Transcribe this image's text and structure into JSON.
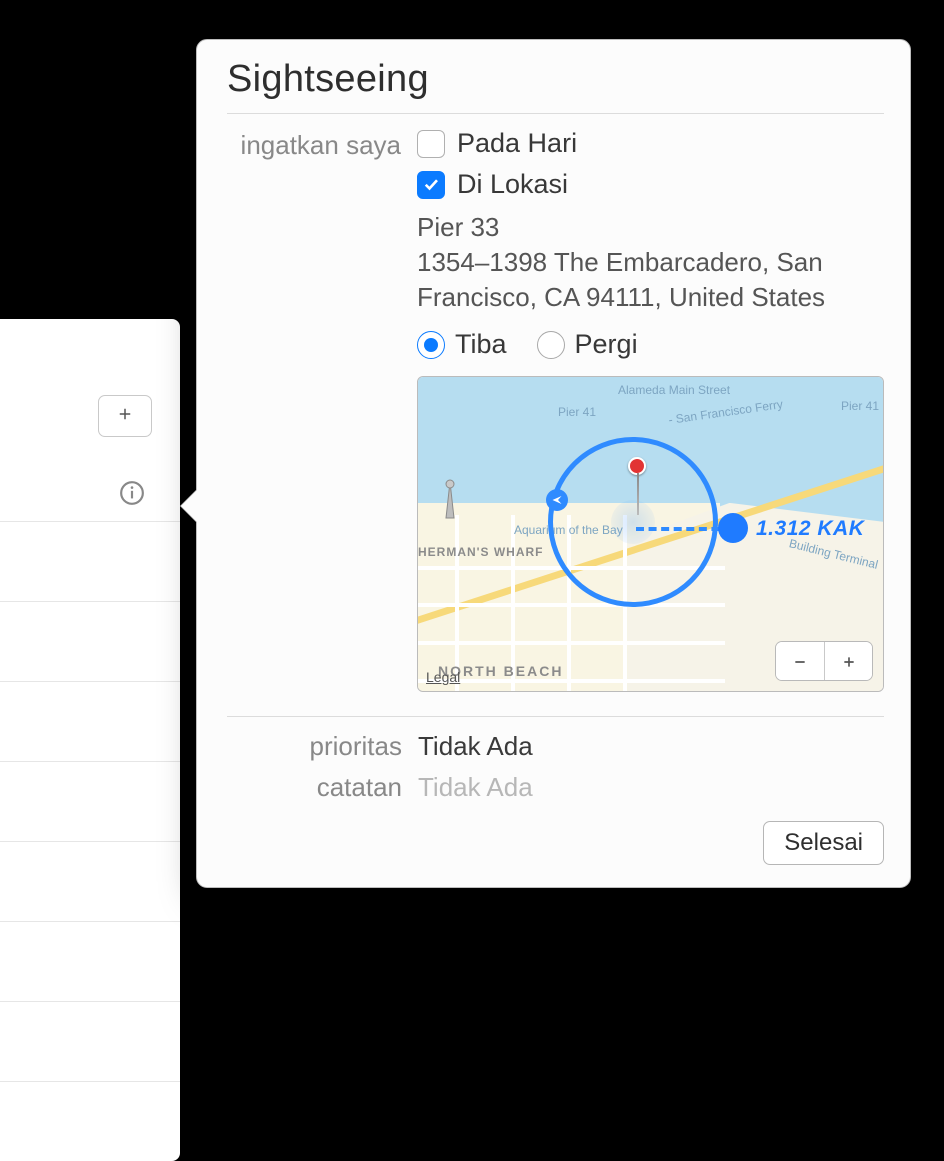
{
  "popover": {
    "title": "Sightseeing",
    "remind_me_label": "ingatkan saya",
    "options": {
      "on_day": {
        "label": "Pada Hari",
        "checked": false
      },
      "at_location": {
        "label": "Di Lokasi",
        "checked": true
      }
    },
    "location": {
      "name": "Pier 33",
      "address_line": "1354–1398 The Embarcadero, San Francisco, CA  94111, United States"
    },
    "radios": {
      "arrive": {
        "label": "Tiba",
        "selected": true
      },
      "leave": {
        "label": "Pergi",
        "selected": false
      }
    },
    "map": {
      "labels": {
        "alameda": "Alameda Main Street",
        "pier41": "Pier 41",
        "pier41b": "Pier 41",
        "ferry_arc": "- San Francisco Ferry",
        "building_term": "Building Terminal",
        "aquarium": "Aquarium of the Bay",
        "hermans_wharf": "HERMAN'S WHARF",
        "north_beach": "NORTH BEACH"
      },
      "distance_label": "1.312 KAK",
      "legal": "Legal"
    },
    "priority": {
      "label": "prioritas",
      "value": "Tidak Ada"
    },
    "notes": {
      "label": "catatan",
      "placeholder": "Tidak Ada"
    },
    "done_button": "Selesai"
  }
}
